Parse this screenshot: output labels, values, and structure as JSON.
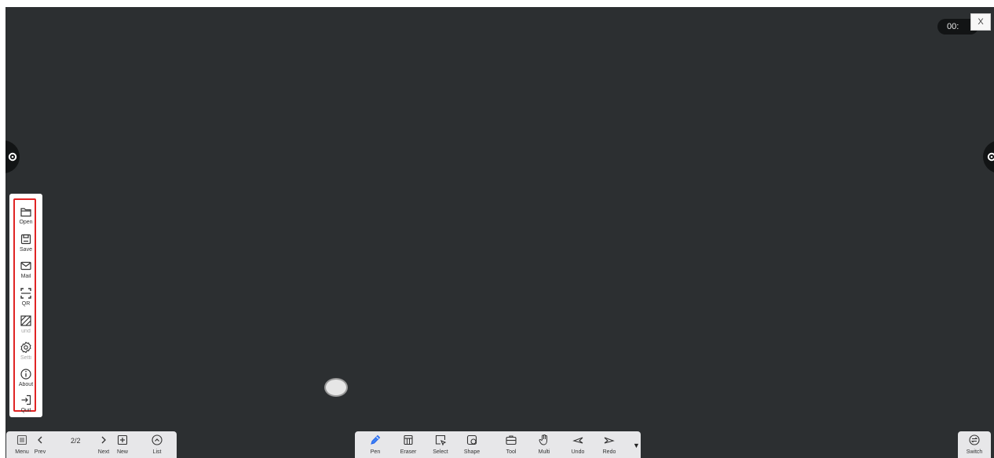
{
  "timer": {
    "text": "00:"
  },
  "close": {
    "label": "X"
  },
  "side_menu": {
    "items": [
      {
        "label": "Open",
        "icon": "folder-icon"
      },
      {
        "label": "Save",
        "icon": "save-icon"
      },
      {
        "label": "Mail",
        "icon": "mail-icon"
      },
      {
        "label": "QR",
        "icon": "qr-scan-icon"
      },
      {
        "label": "und",
        "icon": "background-icon"
      },
      {
        "label": "Setti",
        "icon": "gear-icon"
      },
      {
        "label": "About",
        "icon": "info-icon"
      },
      {
        "label": "Quit",
        "icon": "exit-icon"
      }
    ],
    "highlight_color": "#e02424"
  },
  "nav_toolbar": {
    "menu_label": "Menu",
    "prev_label": "Prev",
    "page_count": "2/2",
    "next_label": "Next",
    "new_label": "New",
    "list_label": "List"
  },
  "main_toolbar": {
    "items": [
      {
        "label": "Pen",
        "icon": "pen-icon",
        "active": true
      },
      {
        "label": "Eraser",
        "icon": "eraser-icon"
      },
      {
        "label": "Select",
        "icon": "select-icon"
      },
      {
        "label": "Shape",
        "icon": "shape-icon"
      },
      {
        "label": "Tool",
        "icon": "toolbox-icon"
      },
      {
        "label": "Multi",
        "icon": "hand-icon"
      },
      {
        "label": "Undo",
        "icon": "undo-icon"
      },
      {
        "label": "Redo",
        "icon": "redo-icon"
      }
    ],
    "more_icon": "caret-down-icon",
    "active_color": "#3b82f6"
  },
  "switch_toolbar": {
    "label": "Switch",
    "icon": "switch-icon"
  },
  "colors": {
    "board": "#2c2f31",
    "toolbar": "#e7e7e9"
  }
}
